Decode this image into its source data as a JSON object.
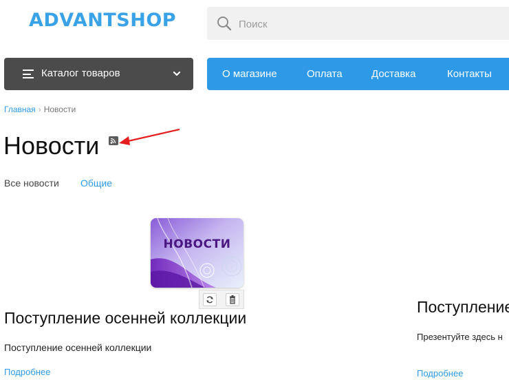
{
  "header": {
    "logo": "ADVANTSHOP",
    "search": {
      "placeholder": "Поиск",
      "icon": "search-icon"
    }
  },
  "nav": {
    "catalog_label": "Каталог товаров",
    "menu": [
      "О магазине",
      "Оплата",
      "Доставка",
      "Контакты"
    ]
  },
  "breadcrumb": {
    "home": "Главная",
    "separator": "›",
    "current": "Новости"
  },
  "page": {
    "title": "Новости"
  },
  "tabs": {
    "all": "Все новости",
    "general": "Общие"
  },
  "news": [
    {
      "image_text": "НОВОСТИ",
      "title": "Поступление осенней коллекции",
      "text": "Поступление осенней коллекции",
      "more": "Подробнее"
    },
    {
      "title": "Поступление",
      "text": "Презентуйте здесь н",
      "more": "Подробнее"
    }
  ],
  "colors": {
    "accent": "#2e9ae7",
    "logo": "#3aa2e6",
    "catalog_bg": "#4b4b4b",
    "annotation_arrow": "#e41e1e"
  }
}
